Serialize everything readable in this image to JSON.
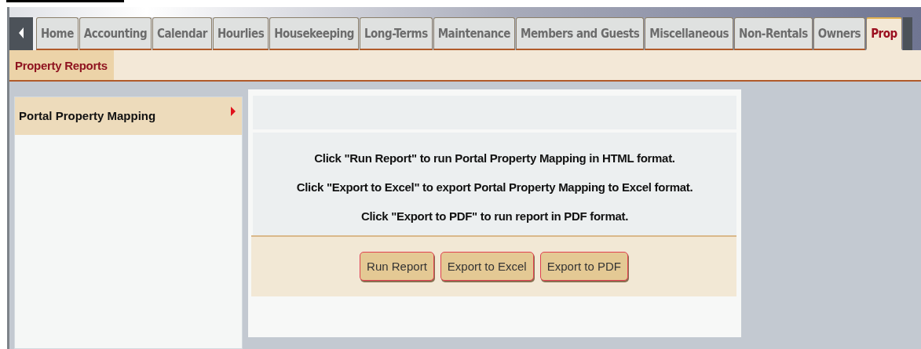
{
  "tabs": [
    {
      "label": "Home",
      "selected": false
    },
    {
      "label": "Accounting",
      "selected": false
    },
    {
      "label": "Calendar",
      "selected": false
    },
    {
      "label": "Hourlies",
      "selected": false
    },
    {
      "label": "Housekeeping",
      "selected": false
    },
    {
      "label": "Long-Terms",
      "selected": false
    },
    {
      "label": "Maintenance",
      "selected": false
    },
    {
      "label": "Members and Guests",
      "selected": false
    },
    {
      "label": "Miscellaneous",
      "selected": false
    },
    {
      "label": "Non-Rentals",
      "selected": false
    },
    {
      "label": "Owners",
      "selected": false
    },
    {
      "label": "Prop",
      "selected": true
    }
  ],
  "subtabs": [
    {
      "label": "Property Reports",
      "selected": true
    }
  ],
  "sidebar": {
    "items": [
      {
        "label": "Portal Property Mapping",
        "selected": true
      }
    ]
  },
  "report": {
    "instructions": [
      "Click \"Run Report\" to run Portal Property Mapping in HTML format.",
      "Click \"Export to Excel\" to export Portal Property Mapping to Excel format.",
      "Click \"Export to PDF\" to run report in PDF format."
    ],
    "buttons": [
      "Run Report",
      "Export to Excel",
      "Export to PDF"
    ]
  }
}
